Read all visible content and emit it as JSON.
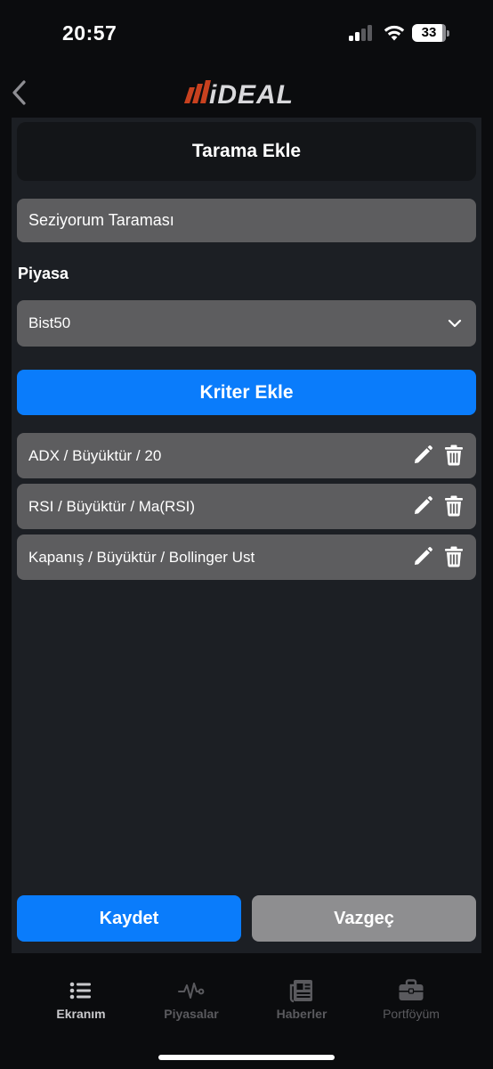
{
  "status_bar": {
    "time": "20:57",
    "battery": "33"
  },
  "app": {
    "logo_text": "iDEAL"
  },
  "header": {
    "title": "Tarama Ekle"
  },
  "form": {
    "name_value": "Seziyorum Taraması",
    "market_label": "Piyasa",
    "market_value": "Bist50",
    "add_criteria_label": "Kriter Ekle"
  },
  "criteria": [
    {
      "text": "ADX / Büyüktür / 20"
    },
    {
      "text": "RSI / Büyüktür / Ma(RSI)"
    },
    {
      "text": "Kapanış / Büyüktür / Bollinger Ust"
    }
  ],
  "actions": {
    "save_label": "Kaydet",
    "cancel_label": "Vazgeç"
  },
  "tab_bar": {
    "tabs": [
      {
        "label": "Ekranım",
        "icon": "list-icon",
        "active": true
      },
      {
        "label": "Piyasalar",
        "icon": "pulse-icon",
        "active": false
      },
      {
        "label": "Haberler",
        "icon": "newspaper-icon",
        "active": false
      },
      {
        "label": "Portföyüm",
        "icon": "briefcase-icon",
        "active": false
      }
    ]
  },
  "colors": {
    "accent": "#0a7cfb",
    "field_bg": "#5d5d5f",
    "panel_bg": "#1c1f24",
    "logo_red": "#c8411f",
    "tab_active": "#c9c9cc",
    "tab_inactive": "#5a5a5e"
  }
}
